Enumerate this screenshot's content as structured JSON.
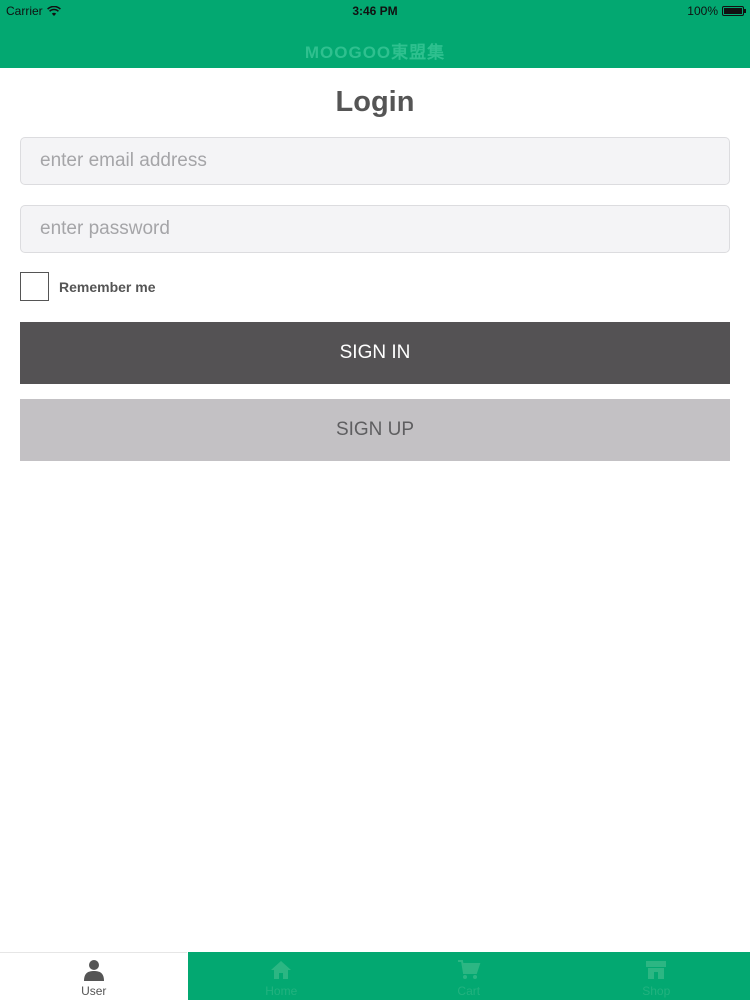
{
  "status_bar": {
    "carrier": "Carrier",
    "time": "3:46 PM",
    "battery": "100%"
  },
  "header": {
    "app_title": "MOOGOO東盟集"
  },
  "login": {
    "title": "Login",
    "email_placeholder": "enter email address",
    "password_placeholder": "enter password",
    "remember_label": "Remember me",
    "sign_in_label": "SIGN IN",
    "sign_up_label": "SIGN UP"
  },
  "tabbar": {
    "tabs": [
      {
        "label": "User",
        "icon": "user-icon",
        "active": true
      },
      {
        "label": "Home",
        "icon": "home-icon",
        "active": false
      },
      {
        "label": "Cart",
        "icon": "cart-icon",
        "active": false
      },
      {
        "label": "Shop",
        "icon": "shop-icon",
        "active": false
      }
    ]
  },
  "colors": {
    "brand_green": "#03a871",
    "sign_in_bg": "#545254",
    "sign_up_bg": "#c3c1c4"
  }
}
